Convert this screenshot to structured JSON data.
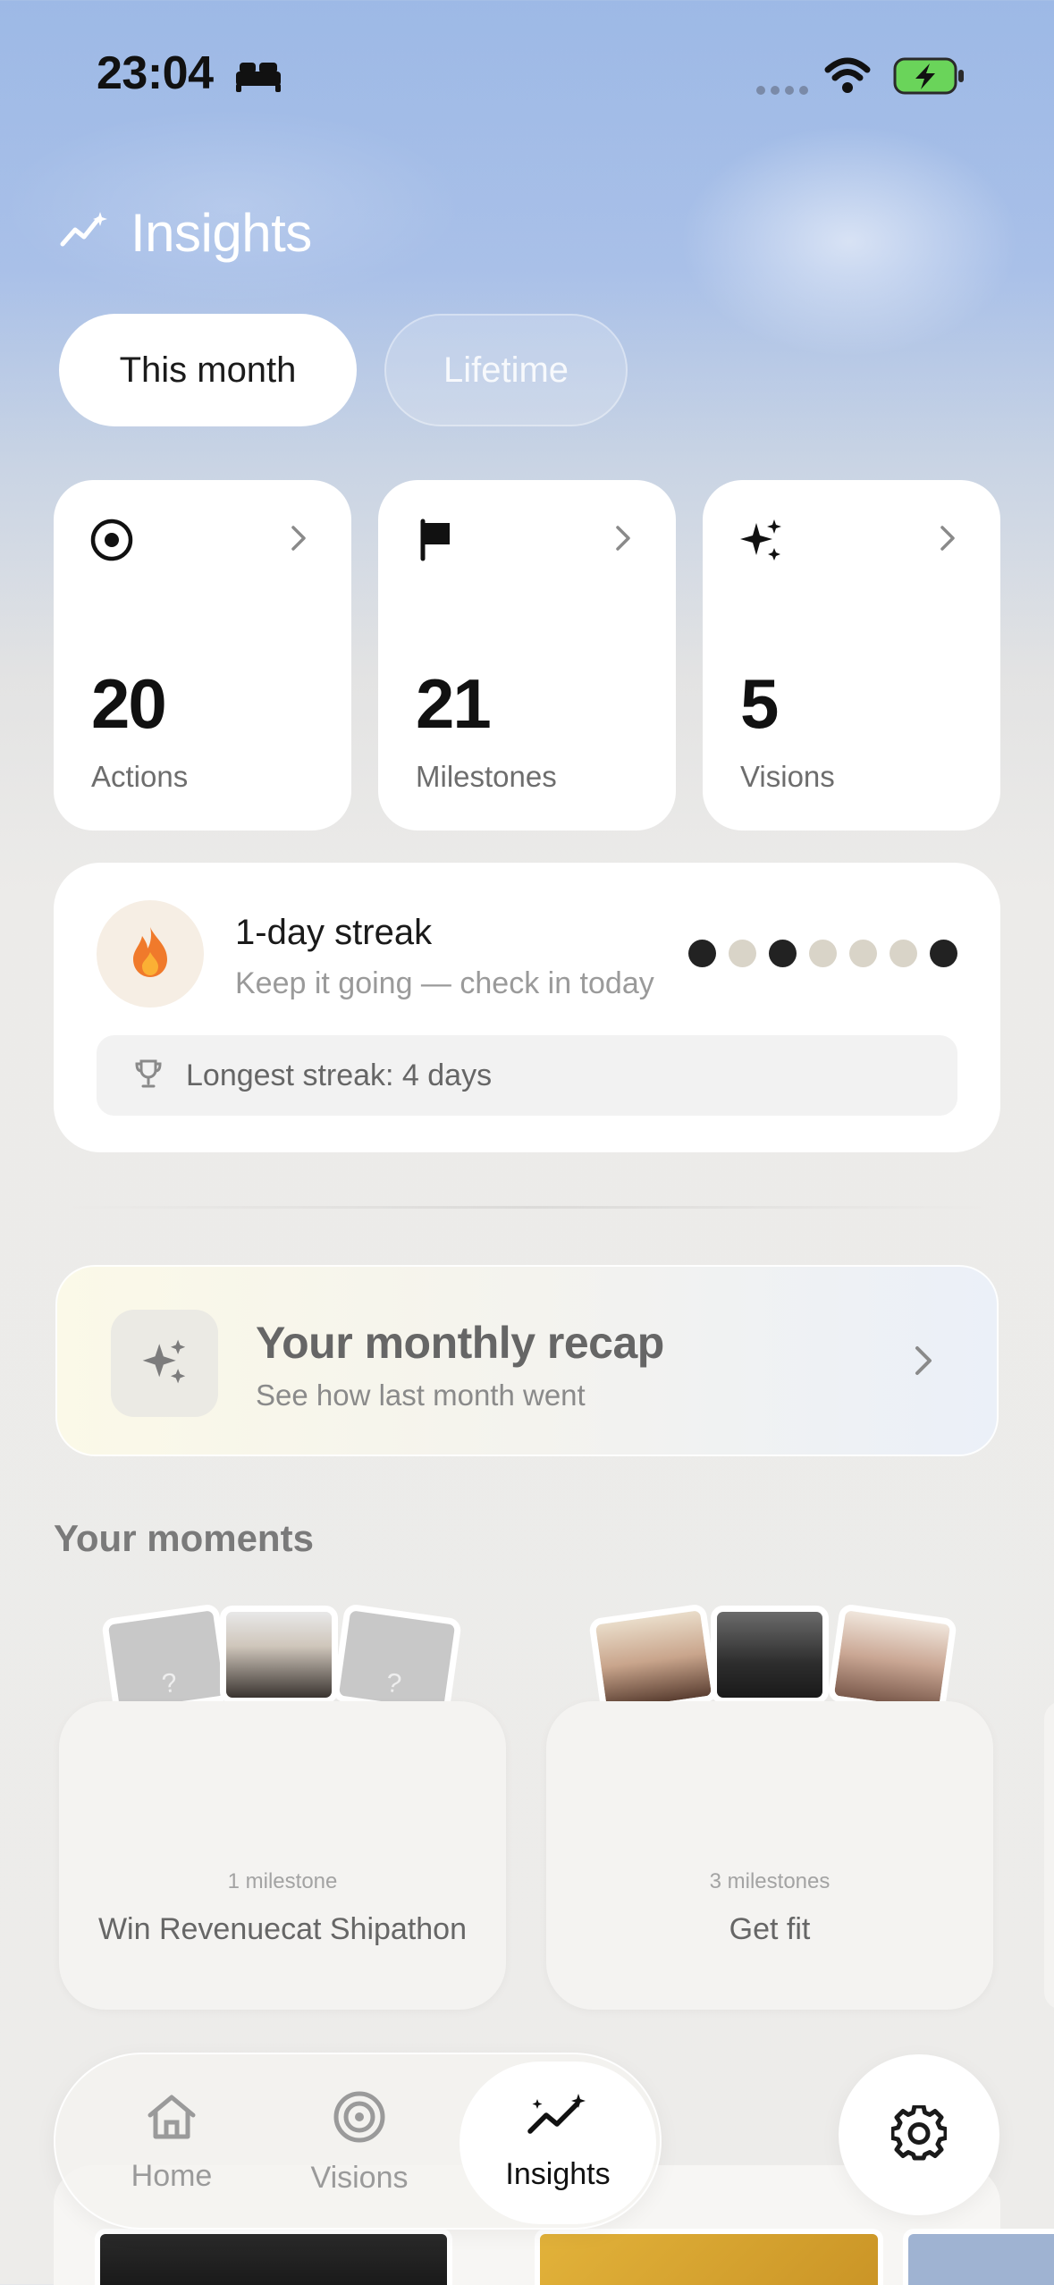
{
  "status_bar": {
    "time": "23:04"
  },
  "header": {
    "title": "Insights"
  },
  "period_tabs": [
    {
      "label": "This month",
      "active": true
    },
    {
      "label": "Lifetime",
      "active": false
    }
  ],
  "stats": [
    {
      "icon": "target-icon",
      "value": "20",
      "label": "Actions"
    },
    {
      "icon": "flag-icon",
      "value": "21",
      "label": "Milestones"
    },
    {
      "icon": "sparkles-icon",
      "value": "5",
      "label": "Visions"
    }
  ],
  "streak": {
    "title": "1-day streak",
    "subtitle": "Keep it going — check in today",
    "days_filled": [
      true,
      false,
      true,
      false,
      false,
      false,
      true
    ],
    "longest": "Longest streak: 4 days"
  },
  "recap": {
    "title": "Your monthly recap",
    "subtitle": "See how last month went"
  },
  "moments": {
    "section_title": "Your moments",
    "items": [
      {
        "count": "1 milestone",
        "name": "Win Revenuecat Shipathon"
      },
      {
        "count": "3 milestones",
        "name": "Get fit"
      }
    ]
  },
  "tabbar": {
    "items": [
      {
        "label": "Home",
        "icon": "home-icon"
      },
      {
        "label": "Visions",
        "icon": "visions-icon"
      },
      {
        "label": "Insights",
        "icon": "insights-icon",
        "active": true
      }
    ]
  },
  "colors": {
    "accent_dark": "#222222",
    "dot_empty": "#d9d4c8",
    "flame": "#f07a2b"
  }
}
